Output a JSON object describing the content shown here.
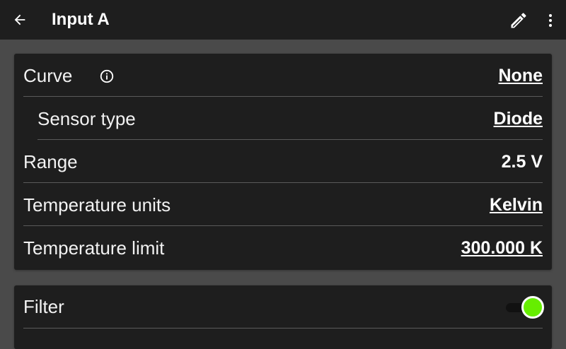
{
  "appbar": {
    "title": "Input A",
    "icons": {
      "back": "arrow-left-icon",
      "edit": "pencil-icon",
      "more": "more-vert-icon"
    }
  },
  "settings": {
    "curve": {
      "label": "Curve",
      "value": "None"
    },
    "sensor_type": {
      "label": "Sensor type",
      "value": "Diode"
    },
    "range": {
      "label": "Range",
      "value": "2.5 V"
    },
    "temperature_units": {
      "label": "Temperature units",
      "value": "Kelvin"
    },
    "temperature_limit": {
      "label": "Temperature limit",
      "value": "300.000 K"
    }
  },
  "filter": {
    "label": "Filter",
    "enabled": true,
    "toggle_color": "#66ee00"
  },
  "colors": {
    "background": "#4a4a4a",
    "surface": "#1e1e1e",
    "divider": "#5a5a5a",
    "accent": "#66ee00"
  }
}
